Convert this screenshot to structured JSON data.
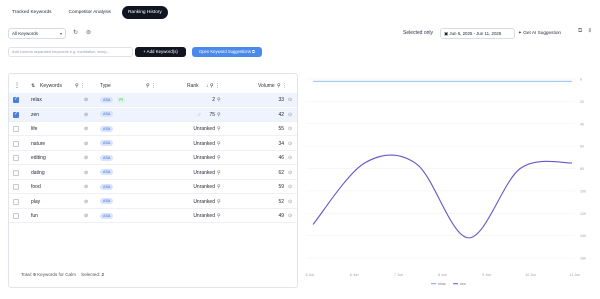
{
  "tabs": [
    {
      "label": "Tracked Keywords",
      "active": false
    },
    {
      "label": "Competitor Analysis",
      "active": false
    },
    {
      "label": "Ranking History",
      "active": true
    }
  ],
  "toolbar": {
    "store_select": "All Keywords",
    "selected_only": "Selected only",
    "date_range": "Jun 6, 2025 - Jun 11, 2025",
    "ai_suggestion": "Get AI Suggestion"
  },
  "add": {
    "placeholder": "Add comma separated keywords e.g. meditation, sleep...",
    "add_button": "Add Keyword(s)",
    "open_button": "Open Keyword Suggestions"
  },
  "table": {
    "headers": {
      "keywords": "Keywords",
      "type": "Type",
      "rank": "Rank",
      "volume": "Volume"
    },
    "rows": [
      {
        "keyword": "relax",
        "type": "ASA",
        "extra_badge": "PI",
        "rank": "2",
        "rank_delta": "",
        "volume": "33",
        "checked": true
      },
      {
        "keyword": "zen",
        "type": "ASA",
        "extra_badge": "",
        "rank": "75",
        "rank_delta": "↓7",
        "volume": "42",
        "checked": true
      },
      {
        "keyword": "life",
        "type": "ASA",
        "extra_badge": "",
        "rank": "Unranked",
        "rank_delta": "",
        "volume": "55",
        "checked": false
      },
      {
        "keyword": "nature",
        "type": "ASA",
        "extra_badge": "",
        "rank": "Unranked",
        "rank_delta": "",
        "volume": "34",
        "checked": false
      },
      {
        "keyword": "editing",
        "type": "ASA",
        "extra_badge": "",
        "rank": "Unranked",
        "rank_delta": "",
        "volume": "46",
        "checked": false
      },
      {
        "keyword": "dating",
        "type": "ASA",
        "extra_badge": "",
        "rank": "Unranked",
        "rank_delta": "",
        "volume": "62",
        "checked": false
      },
      {
        "keyword": "food",
        "type": "ASA",
        "extra_badge": "",
        "rank": "Unranked",
        "rank_delta": "",
        "volume": "59",
        "checked": false
      },
      {
        "keyword": "play",
        "type": "ASA",
        "extra_badge": "",
        "rank": "Unranked",
        "rank_delta": "",
        "volume": "52",
        "checked": false
      },
      {
        "keyword": "fun",
        "type": "ASA",
        "extra_badge": "",
        "rank": "Unranked",
        "rank_delta": "",
        "volume": "49",
        "checked": false
      }
    ],
    "footer_total_label": "Total:",
    "footer_total_count": "9",
    "footer_total_suffix": "Keywords for Calm",
    "footer_selected_label": "Selected:",
    "footer_selected_count": "2"
  },
  "chart_data": {
    "type": "line",
    "x": [
      "6 Jun",
      "7 Jun",
      "8 Jun",
      "9 Jun",
      "10 Jun",
      "11 Jun"
    ],
    "x_ticks": [
      "6 Jun",
      "6 Jun",
      "7 Jun",
      "8 Jun",
      "9 Jun",
      "10 Jun",
      "11 Jun"
    ],
    "y_ticks": [
      "0",
      "20",
      "40",
      "60",
      "80",
      "100",
      "120",
      "140",
      "160"
    ],
    "ylim": [
      0,
      160
    ],
    "inverted": true,
    "series": [
      {
        "name": "relax",
        "color": "#6ea6e8",
        "values": [
          2,
          2,
          2,
          2,
          2,
          2
        ]
      },
      {
        "name": "zen",
        "color": "#6a54c9",
        "values": [
          130,
          75,
          76,
          142,
          80,
          75
        ]
      }
    ],
    "legend_position": "bottom"
  }
}
